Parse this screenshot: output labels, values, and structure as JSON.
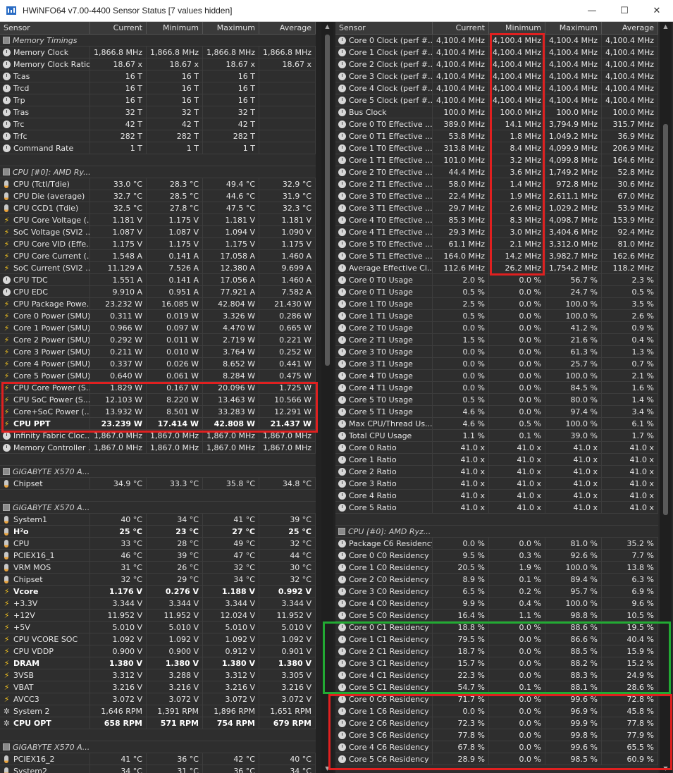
{
  "window": {
    "title": "HWiNFO64 v7.00-4400 Sensor Status [7 values hidden]",
    "minimize": "—",
    "maximize": "☐",
    "close": "✕"
  },
  "columns": {
    "sensor": "Sensor",
    "current": "Current",
    "minimum": "Minimum",
    "maximum": "Maximum",
    "average": "Average"
  },
  "left_rows": [
    {
      "t": "group",
      "n": "Memory Timings"
    },
    {
      "i": "clock",
      "n": "Memory Clock",
      "v": [
        "1,866.8 MHz",
        "1,866.8 MHz",
        "1,866.8 MHz",
        "1,866.8 MHz"
      ]
    },
    {
      "i": "clock",
      "n": "Memory Clock Ratio",
      "v": [
        "18.67 x",
        "18.67 x",
        "18.67 x",
        "18.67 x"
      ]
    },
    {
      "i": "clock",
      "n": "Tcas",
      "v": [
        "16 T",
        "16 T",
        "16 T",
        ""
      ]
    },
    {
      "i": "clock",
      "n": "Trcd",
      "v": [
        "16 T",
        "16 T",
        "16 T",
        ""
      ]
    },
    {
      "i": "clock",
      "n": "Trp",
      "v": [
        "16 T",
        "16 T",
        "16 T",
        ""
      ]
    },
    {
      "i": "clock",
      "n": "Tras",
      "v": [
        "32 T",
        "32 T",
        "32 T",
        ""
      ]
    },
    {
      "i": "clock",
      "n": "Trc",
      "v": [
        "42 T",
        "42 T",
        "42 T",
        ""
      ]
    },
    {
      "i": "clock",
      "n": "Trfc",
      "v": [
        "282 T",
        "282 T",
        "282 T",
        ""
      ]
    },
    {
      "i": "clock",
      "n": "Command Rate",
      "v": [
        "1 T",
        "1 T",
        "1 T",
        ""
      ]
    },
    {
      "t": "blank"
    },
    {
      "t": "group",
      "n": "CPU [#0]: AMD Ry..."
    },
    {
      "i": "therm",
      "n": "CPU (Tctl/Tdie)",
      "v": [
        "33.0 °C",
        "28.3 °C",
        "49.4 °C",
        "32.9 °C"
      ]
    },
    {
      "i": "therm",
      "n": "CPU Die (average)",
      "v": [
        "32.7 °C",
        "28.5 °C",
        "44.6 °C",
        "31.9 °C"
      ]
    },
    {
      "i": "therm",
      "n": "CPU CCD1 (Tdie)",
      "v": [
        "32.5 °C",
        "27.8 °C",
        "47.5 °C",
        "32.3 °C"
      ]
    },
    {
      "i": "volt",
      "n": "CPU Core Voltage (...",
      "v": [
        "1.181 V",
        "1.175 V",
        "1.181 V",
        "1.181 V"
      ]
    },
    {
      "i": "volt",
      "n": "SoC Voltage (SVI2 ...",
      "v": [
        "1.087 V",
        "1.087 V",
        "1.094 V",
        "1.090 V"
      ]
    },
    {
      "i": "volt",
      "n": "CPU Core VID (Effe...",
      "v": [
        "1.175 V",
        "1.175 V",
        "1.175 V",
        "1.175 V"
      ]
    },
    {
      "i": "volt",
      "n": "CPU Core Current (...",
      "v": [
        "1.548 A",
        "0.141 A",
        "17.058 A",
        "1.460 A"
      ]
    },
    {
      "i": "volt",
      "n": "SoC Current (SVI2 ...",
      "v": [
        "11.129 A",
        "7.526 A",
        "12.380 A",
        "9.699 A"
      ]
    },
    {
      "i": "clock",
      "n": "CPU TDC",
      "v": [
        "1.551 A",
        "0.141 A",
        "17.056 A",
        "1.460 A"
      ]
    },
    {
      "i": "clock",
      "n": "CPU EDC",
      "v": [
        "9.910 A",
        "0.951 A",
        "77.921 A",
        "7.582 A"
      ]
    },
    {
      "i": "volt",
      "n": "CPU Package Powe...",
      "v": [
        "23.232 W",
        "16.085 W",
        "42.804 W",
        "21.430 W"
      ]
    },
    {
      "i": "volt",
      "n": "Core 0 Power (SMU)",
      "v": [
        "0.311 W",
        "0.019 W",
        "3.326 W",
        "0.286 W"
      ]
    },
    {
      "i": "volt",
      "n": "Core 1 Power (SMU)",
      "v": [
        "0.966 W",
        "0.097 W",
        "4.470 W",
        "0.665 W"
      ]
    },
    {
      "i": "volt",
      "n": "Core 2 Power (SMU)",
      "v": [
        "0.292 W",
        "0.011 W",
        "2.719 W",
        "0.221 W"
      ]
    },
    {
      "i": "volt",
      "n": "Core 3 Power (SMU)",
      "v": [
        "0.211 W",
        "0.010 W",
        "3.764 W",
        "0.252 W"
      ]
    },
    {
      "i": "volt",
      "n": "Core 4 Power (SMU)",
      "v": [
        "0.337 W",
        "0.026 W",
        "8.652 W",
        "0.441 W"
      ]
    },
    {
      "i": "volt",
      "n": "Core 5 Power (SMU)",
      "v": [
        "0.640 W",
        "0.061 W",
        "8.284 W",
        "0.475 W"
      ]
    },
    {
      "i": "volt",
      "n": "CPU Core Power (S...",
      "v": [
        "1.829 W",
        "0.167 W",
        "20.096 W",
        "1.725 W"
      ]
    },
    {
      "i": "volt",
      "n": "CPU SoC Power (S...",
      "v": [
        "12.103 W",
        "8.220 W",
        "13.463 W",
        "10.566 W"
      ]
    },
    {
      "i": "volt",
      "n": "Core+SoC Power (...",
      "v": [
        "13.932 W",
        "8.501 W",
        "33.283 W",
        "12.291 W"
      ]
    },
    {
      "i": "volt",
      "n": "CPU PPT",
      "v": [
        "23.239 W",
        "17.414 W",
        "42.808 W",
        "21.437 W"
      ],
      "b": true
    },
    {
      "i": "clock",
      "n": "Infinity Fabric Cloc...",
      "v": [
        "1,867.0 MHz",
        "1,867.0 MHz",
        "1,867.0 MHz",
        "1,867.0 MHz"
      ]
    },
    {
      "i": "clock",
      "n": "Memory Controller ...",
      "v": [
        "1,867.0 MHz",
        "1,867.0 MHz",
        "1,867.0 MHz",
        "1,867.0 MHz"
      ]
    },
    {
      "t": "blank"
    },
    {
      "t": "group",
      "n": "GIGABYTE X570 A..."
    },
    {
      "i": "therm",
      "n": "Chipset",
      "v": [
        "34.9 °C",
        "33.3 °C",
        "35.8 °C",
        "34.8 °C"
      ]
    },
    {
      "t": "blank"
    },
    {
      "t": "group",
      "n": "GIGABYTE X570 A..."
    },
    {
      "i": "therm",
      "n": "System1",
      "v": [
        "40 °C",
        "34 °C",
        "41 °C",
        "39 °C"
      ]
    },
    {
      "i": "therm",
      "n": "H²o",
      "v": [
        "25 °C",
        "23 °C",
        "27 °C",
        "25 °C"
      ],
      "b": true
    },
    {
      "i": "therm",
      "n": "CPU",
      "v": [
        "33 °C",
        "28 °C",
        "49 °C",
        "32 °C"
      ]
    },
    {
      "i": "therm",
      "n": "PCIEX16_1",
      "v": [
        "46 °C",
        "39 °C",
        "47 °C",
        "44 °C"
      ]
    },
    {
      "i": "therm",
      "n": "VRM MOS",
      "v": [
        "31 °C",
        "26 °C",
        "32 °C",
        "30 °C"
      ]
    },
    {
      "i": "therm",
      "n": "Chipset",
      "v": [
        "32 °C",
        "29 °C",
        "34 °C",
        "32 °C"
      ]
    },
    {
      "i": "volt",
      "n": "Vcore",
      "v": [
        "1.176 V",
        "0.276 V",
        "1.188 V",
        "0.992 V"
      ],
      "b": true
    },
    {
      "i": "volt",
      "n": "+3.3V",
      "v": [
        "3.344 V",
        "3.344 V",
        "3.344 V",
        "3.344 V"
      ]
    },
    {
      "i": "volt",
      "n": "+12V",
      "v": [
        "11.952 V",
        "11.952 V",
        "12.024 V",
        "11.952 V"
      ]
    },
    {
      "i": "volt",
      "n": "+5V",
      "v": [
        "5.010 V",
        "5.010 V",
        "5.010 V",
        "5.010 V"
      ]
    },
    {
      "i": "volt",
      "n": "CPU VCORE SOC",
      "v": [
        "1.092 V",
        "1.092 V",
        "1.092 V",
        "1.092 V"
      ]
    },
    {
      "i": "volt",
      "n": "CPU VDDP",
      "v": [
        "0.900 V",
        "0.900 V",
        "0.912 V",
        "0.901 V"
      ]
    },
    {
      "i": "volt",
      "n": "DRAM",
      "v": [
        "1.380 V",
        "1.380 V",
        "1.380 V",
        "1.380 V"
      ],
      "b": true
    },
    {
      "i": "volt",
      "n": "3VSB",
      "v": [
        "3.312 V",
        "3.288 V",
        "3.312 V",
        "3.305 V"
      ]
    },
    {
      "i": "volt",
      "n": "VBAT",
      "v": [
        "3.216 V",
        "3.216 V",
        "3.216 V",
        "3.216 V"
      ]
    },
    {
      "i": "volt",
      "n": "AVCC3",
      "v": [
        "3.072 V",
        "3.072 V",
        "3.072 V",
        "3.072 V"
      ]
    },
    {
      "i": "fan",
      "n": "System 2",
      "v": [
        "1,646 RPM",
        "1,391 RPM",
        "1,896 RPM",
        "1,651 RPM"
      ]
    },
    {
      "i": "fan",
      "n": "CPU OPT",
      "v": [
        "658 RPM",
        "571 RPM",
        "754 RPM",
        "679 RPM"
      ],
      "b": true
    },
    {
      "t": "blank"
    },
    {
      "t": "group",
      "n": "GIGABYTE X570 A..."
    },
    {
      "i": "therm",
      "n": "PCIEX16_2",
      "v": [
        "41 °C",
        "36 °C",
        "42 °C",
        "40 °C"
      ]
    },
    {
      "i": "therm",
      "n": "System2",
      "v": [
        "34 °C",
        "31 °C",
        "36 °C",
        "34 °C"
      ]
    }
  ],
  "right_rows": [
    {
      "i": "clock",
      "n": "Core 0 Clock (perf #...",
      "v": [
        "4,100.4 MHz",
        "4,100.4 MHz",
        "4,100.4 MHz",
        "4,100.4 MHz"
      ]
    },
    {
      "i": "clock",
      "n": "Core 1 Clock (perf #...",
      "v": [
        "4,100.4 MHz",
        "4,100.4 MHz",
        "4,100.4 MHz",
        "4,100.4 MHz"
      ]
    },
    {
      "i": "clock",
      "n": "Core 2 Clock (perf #...",
      "v": [
        "4,100.4 MHz",
        "4,100.4 MHz",
        "4,100.4 MHz",
        "4,100.4 MHz"
      ]
    },
    {
      "i": "clock",
      "n": "Core 3 Clock (perf #...",
      "v": [
        "4,100.4 MHz",
        "4,100.4 MHz",
        "4,100.4 MHz",
        "4,100.4 MHz"
      ]
    },
    {
      "i": "clock",
      "n": "Core 4 Clock (perf #...",
      "v": [
        "4,100.4 MHz",
        "4,100.4 MHz",
        "4,100.4 MHz",
        "4,100.4 MHz"
      ]
    },
    {
      "i": "clock",
      "n": "Core 5 Clock (perf #...",
      "v": [
        "4,100.4 MHz",
        "4,100.4 MHz",
        "4,100.4 MHz",
        "4,100.4 MHz"
      ]
    },
    {
      "i": "clock",
      "n": "Bus Clock",
      "v": [
        "100.0 MHz",
        "100.0 MHz",
        "100.0 MHz",
        "100.0 MHz"
      ]
    },
    {
      "i": "clock",
      "n": "Core 0 T0 Effective ...",
      "v": [
        "389.0 MHz",
        "14.1 MHz",
        "3,794.9 MHz",
        "315.7 MHz"
      ]
    },
    {
      "i": "clock",
      "n": "Core 0 T1 Effective ...",
      "v": [
        "53.8 MHz",
        "1.8 MHz",
        "1,049.2 MHz",
        "36.9 MHz"
      ]
    },
    {
      "i": "clock",
      "n": "Core 1 T0 Effective ...",
      "v": [
        "313.8 MHz",
        "8.4 MHz",
        "4,099.9 MHz",
        "206.9 MHz"
      ]
    },
    {
      "i": "clock",
      "n": "Core 1 T1 Effective ...",
      "v": [
        "101.0 MHz",
        "3.2 MHz",
        "4,099.8 MHz",
        "164.6 MHz"
      ]
    },
    {
      "i": "clock",
      "n": "Core 2 T0 Effective ...",
      "v": [
        "44.4 MHz",
        "3.6 MHz",
        "1,749.2 MHz",
        "52.8 MHz"
      ]
    },
    {
      "i": "clock",
      "n": "Core 2 T1 Effective ...",
      "v": [
        "58.0 MHz",
        "1.4 MHz",
        "972.8 MHz",
        "30.6 MHz"
      ]
    },
    {
      "i": "clock",
      "n": "Core 3 T0 Effective ...",
      "v": [
        "22.4 MHz",
        "1.9 MHz",
        "2,611.1 MHz",
        "67.0 MHz"
      ]
    },
    {
      "i": "clock",
      "n": "Core 3 T1 Effective ...",
      "v": [
        "29.7 MHz",
        "2.6 MHz",
        "1,029.2 MHz",
        "53.9 MHz"
      ]
    },
    {
      "i": "clock",
      "n": "Core 4 T0 Effective ...",
      "v": [
        "85.3 MHz",
        "8.3 MHz",
        "4,098.7 MHz",
        "153.9 MHz"
      ]
    },
    {
      "i": "clock",
      "n": "Core 4 T1 Effective ...",
      "v": [
        "29.3 MHz",
        "3.0 MHz",
        "3,404.6 MHz",
        "92.4 MHz"
      ]
    },
    {
      "i": "clock",
      "n": "Core 5 T0 Effective ...",
      "v": [
        "61.1 MHz",
        "2.1 MHz",
        "3,312.0 MHz",
        "81.0 MHz"
      ]
    },
    {
      "i": "clock",
      "n": "Core 5 T1 Effective ...",
      "v": [
        "164.0 MHz",
        "14.2 MHz",
        "3,982.7 MHz",
        "162.6 MHz"
      ]
    },
    {
      "i": "clock",
      "n": "Average Effective Cl...",
      "v": [
        "112.6 MHz",
        "26.2 MHz",
        "1,754.2 MHz",
        "118.2 MHz"
      ]
    },
    {
      "i": "clock",
      "n": "Core 0 T0 Usage",
      "v": [
        "2.0 %",
        "0.0 %",
        "56.7 %",
        "2.3 %"
      ]
    },
    {
      "i": "clock",
      "n": "Core 0 T1 Usage",
      "v": [
        "0.5 %",
        "0.0 %",
        "24.7 %",
        "0.5 %"
      ]
    },
    {
      "i": "clock",
      "n": "Core 1 T0 Usage",
      "v": [
        "2.5 %",
        "0.0 %",
        "100.0 %",
        "3.5 %"
      ]
    },
    {
      "i": "clock",
      "n": "Core 1 T1 Usage",
      "v": [
        "0.5 %",
        "0.0 %",
        "100.0 %",
        "2.6 %"
      ]
    },
    {
      "i": "clock",
      "n": "Core 2 T0 Usage",
      "v": [
        "0.0 %",
        "0.0 %",
        "41.2 %",
        "0.9 %"
      ]
    },
    {
      "i": "clock",
      "n": "Core 2 T1 Usage",
      "v": [
        "1.5 %",
        "0.0 %",
        "21.6 %",
        "0.4 %"
      ]
    },
    {
      "i": "clock",
      "n": "Core 3 T0 Usage",
      "v": [
        "0.0 %",
        "0.0 %",
        "61.3 %",
        "1.3 %"
      ]
    },
    {
      "i": "clock",
      "n": "Core 3 T1 Usage",
      "v": [
        "0.0 %",
        "0.0 %",
        "25.7 %",
        "0.7 %"
      ]
    },
    {
      "i": "clock",
      "n": "Core 4 T0 Usage",
      "v": [
        "0.0 %",
        "0.0 %",
        "100.0 %",
        "2.1 %"
      ]
    },
    {
      "i": "clock",
      "n": "Core 4 T1 Usage",
      "v": [
        "0.0 %",
        "0.0 %",
        "84.5 %",
        "1.6 %"
      ]
    },
    {
      "i": "clock",
      "n": "Core 5 T0 Usage",
      "v": [
        "0.5 %",
        "0.0 %",
        "80.0 %",
        "1.4 %"
      ]
    },
    {
      "i": "clock",
      "n": "Core 5 T1 Usage",
      "v": [
        "4.6 %",
        "0.0 %",
        "97.4 %",
        "3.4 %"
      ]
    },
    {
      "i": "clock",
      "n": "Max CPU/Thread Us...",
      "v": [
        "4.6 %",
        "0.5 %",
        "100.0 %",
        "6.1 %"
      ]
    },
    {
      "i": "clock",
      "n": "Total CPU Usage",
      "v": [
        "1.1 %",
        "0.1 %",
        "39.0 %",
        "1.7 %"
      ]
    },
    {
      "i": "clock",
      "n": "Core 0 Ratio",
      "v": [
        "41.0 x",
        "41.0 x",
        "41.0 x",
        "41.0 x"
      ]
    },
    {
      "i": "clock",
      "n": "Core 1 Ratio",
      "v": [
        "41.0 x",
        "41.0 x",
        "41.0 x",
        "41.0 x"
      ]
    },
    {
      "i": "clock",
      "n": "Core 2 Ratio",
      "v": [
        "41.0 x",
        "41.0 x",
        "41.0 x",
        "41.0 x"
      ]
    },
    {
      "i": "clock",
      "n": "Core 3 Ratio",
      "v": [
        "41.0 x",
        "41.0 x",
        "41.0 x",
        "41.0 x"
      ]
    },
    {
      "i": "clock",
      "n": "Core 4 Ratio",
      "v": [
        "41.0 x",
        "41.0 x",
        "41.0 x",
        "41.0 x"
      ]
    },
    {
      "i": "clock",
      "n": "Core 5 Ratio",
      "v": [
        "41.0 x",
        "41.0 x",
        "41.0 x",
        "41.0 x"
      ]
    },
    {
      "t": "blank"
    },
    {
      "t": "group",
      "n": "CPU [#0]: AMD Ryz..."
    },
    {
      "i": "clock",
      "n": "Package C6 Residency",
      "v": [
        "0.0 %",
        "0.0 %",
        "81.0 %",
        "35.2 %"
      ]
    },
    {
      "i": "clock",
      "n": "Core 0 C0 Residency",
      "v": [
        "9.5 %",
        "0.3 %",
        "92.6 %",
        "7.7 %"
      ]
    },
    {
      "i": "clock",
      "n": "Core 1 C0 Residency",
      "v": [
        "20.5 %",
        "1.9 %",
        "100.0 %",
        "13.8 %"
      ]
    },
    {
      "i": "clock",
      "n": "Core 2 C0 Residency",
      "v": [
        "8.9 %",
        "0.1 %",
        "89.4 %",
        "6.3 %"
      ]
    },
    {
      "i": "clock",
      "n": "Core 3 C0 Residency",
      "v": [
        "6.5 %",
        "0.2 %",
        "95.7 %",
        "6.9 %"
      ]
    },
    {
      "i": "clock",
      "n": "Core 4 C0 Residency",
      "v": [
        "9.9 %",
        "0.4 %",
        "100.0 %",
        "9.6 %"
      ]
    },
    {
      "i": "clock",
      "n": "Core 5 C0 Residency",
      "v": [
        "16.4 %",
        "1.1 %",
        "98.8 %",
        "10.5 %"
      ]
    },
    {
      "i": "clock",
      "n": "Core 0 C1 Residency",
      "v": [
        "18.8 %",
        "0.0 %",
        "88.6 %",
        "19.5 %"
      ]
    },
    {
      "i": "clock",
      "n": "Core 1 C1 Residency",
      "v": [
        "79.5 %",
        "0.0 %",
        "86.6 %",
        "40.4 %"
      ]
    },
    {
      "i": "clock",
      "n": "Core 2 C1 Residency",
      "v": [
        "18.7 %",
        "0.0 %",
        "88.5 %",
        "15.9 %"
      ]
    },
    {
      "i": "clock",
      "n": "Core 3 C1 Residency",
      "v": [
        "15.7 %",
        "0.0 %",
        "88.2 %",
        "15.2 %"
      ]
    },
    {
      "i": "clock",
      "n": "Core 4 C1 Residency",
      "v": [
        "22.3 %",
        "0.0 %",
        "88.3 %",
        "24.9 %"
      ]
    },
    {
      "i": "clock",
      "n": "Core 5 C1 Residency",
      "v": [
        "54.7 %",
        "0.1 %",
        "88.1 %",
        "28.6 %"
      ]
    },
    {
      "i": "clock",
      "n": "Core 0 C6 Residency",
      "v": [
        "71.7 %",
        "0.0 %",
        "99.6 %",
        "72.8 %"
      ]
    },
    {
      "i": "clock",
      "n": "Core 1 C6 Residency",
      "v": [
        "0.0 %",
        "0.0 %",
        "96.9 %",
        "45.8 %"
      ]
    },
    {
      "i": "clock",
      "n": "Core 2 C6 Residency",
      "v": [
        "72.3 %",
        "0.0 %",
        "99.9 %",
        "77.8 %"
      ]
    },
    {
      "i": "clock",
      "n": "Core 3 C6 Residency",
      "v": [
        "77.8 %",
        "0.0 %",
        "99.8 %",
        "77.9 %"
      ]
    },
    {
      "i": "clock",
      "n": "Core 4 C6 Residency",
      "v": [
        "67.8 %",
        "0.0 %",
        "99.6 %",
        "65.5 %"
      ]
    },
    {
      "i": "clock",
      "n": "Core 5 C6 Residency",
      "v": [
        "28.9 %",
        "0.0 %",
        "98.5 %",
        "60.9 %"
      ]
    }
  ]
}
